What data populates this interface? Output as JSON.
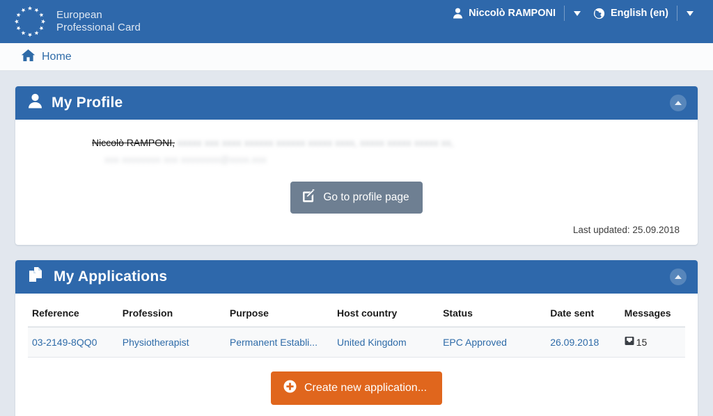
{
  "header": {
    "brand_line1": "European",
    "brand_line2": "Professional Card",
    "logo_icon": "eu-stars-icon",
    "user": {
      "icon": "person-icon",
      "name": "Niccolò RAMPONI",
      "caret_icon": "caret-down-icon"
    },
    "language": {
      "icon": "globe-icon",
      "label": "English (en)",
      "caret_icon": "caret-down-icon"
    },
    "background_color": "#2e68ab"
  },
  "breadcrumb": {
    "icon": "home-icon",
    "label": "Home"
  },
  "profile_panel": {
    "icon": "person-icon",
    "title": "My Profile",
    "collapse_icon": "chevron-up-icon",
    "name_struck": "Niccolò RAMPONI,",
    "redacted_line1": "xxxxx xxx xxxx xxxxxx xxxxxx xxxxx xxxx, xxxxx xxxxx xxxxx xx,",
    "redacted_line2": "xxx xxxxxxxx xxx xxxxxxxx@xxxx.xxx",
    "profile_button": {
      "icon": "edit-square-icon",
      "label": "Go to profile page"
    },
    "last_updated": "Last updated: 25.09.2018"
  },
  "applications_panel": {
    "icon": "documents-icon",
    "title": "My Applications",
    "collapse_icon": "chevron-up-icon",
    "columns": [
      "Reference",
      "Profession",
      "Purpose",
      "Host country",
      "Status",
      "Date sent",
      "Messages"
    ],
    "rows": [
      {
        "reference": "03-2149-8QQ0",
        "profession": "Physiotherapist",
        "purpose": "Permanent Establi...",
        "host_country": "United Kingdom",
        "status": "EPC Approved",
        "date_sent": "26.09.2018",
        "messages_icon": "inbox-icon",
        "messages_count": "15"
      }
    ],
    "create_button": {
      "icon": "plus-circle-icon",
      "label": "Create new application..."
    }
  },
  "colors": {
    "brand_blue": "#2e68ab",
    "link_blue": "#2e6ba8",
    "page_background": "#e2e7ee",
    "button_grey": "#6e7f92",
    "button_orange": "#e0661d"
  }
}
